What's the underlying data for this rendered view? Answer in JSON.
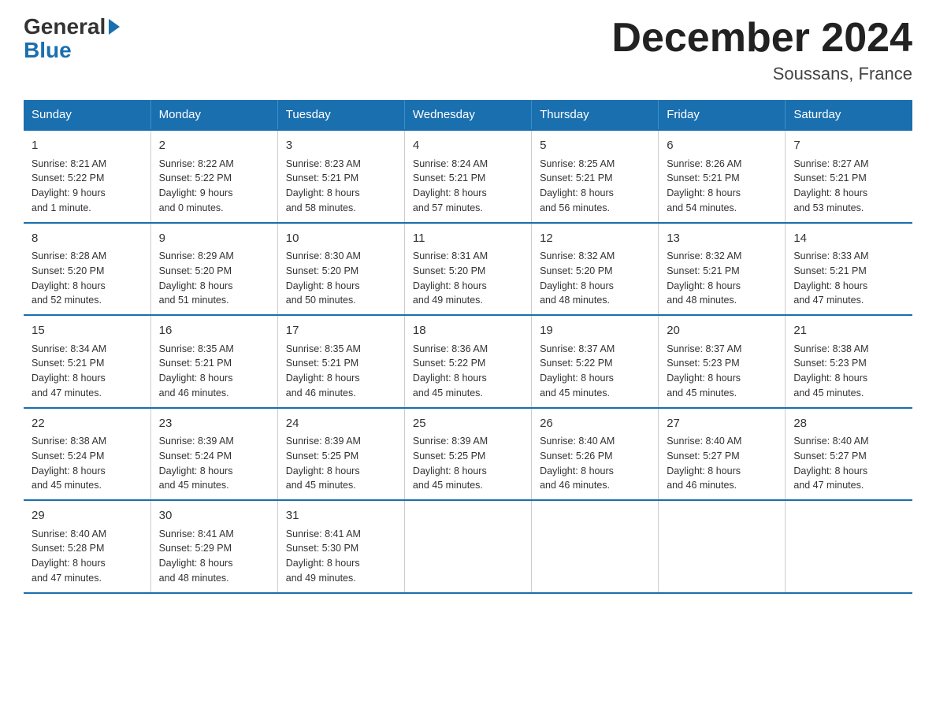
{
  "logo": {
    "general": "General",
    "blue": "Blue"
  },
  "title": "December 2024",
  "subtitle": "Soussans, France",
  "days_of_week": [
    "Sunday",
    "Monday",
    "Tuesday",
    "Wednesday",
    "Thursday",
    "Friday",
    "Saturday"
  ],
  "weeks": [
    [
      {
        "day": "1",
        "info": "Sunrise: 8:21 AM\nSunset: 5:22 PM\nDaylight: 9 hours\nand 1 minute."
      },
      {
        "day": "2",
        "info": "Sunrise: 8:22 AM\nSunset: 5:22 PM\nDaylight: 9 hours\nand 0 minutes."
      },
      {
        "day": "3",
        "info": "Sunrise: 8:23 AM\nSunset: 5:21 PM\nDaylight: 8 hours\nand 58 minutes."
      },
      {
        "day": "4",
        "info": "Sunrise: 8:24 AM\nSunset: 5:21 PM\nDaylight: 8 hours\nand 57 minutes."
      },
      {
        "day": "5",
        "info": "Sunrise: 8:25 AM\nSunset: 5:21 PM\nDaylight: 8 hours\nand 56 minutes."
      },
      {
        "day": "6",
        "info": "Sunrise: 8:26 AM\nSunset: 5:21 PM\nDaylight: 8 hours\nand 54 minutes."
      },
      {
        "day": "7",
        "info": "Sunrise: 8:27 AM\nSunset: 5:21 PM\nDaylight: 8 hours\nand 53 minutes."
      }
    ],
    [
      {
        "day": "8",
        "info": "Sunrise: 8:28 AM\nSunset: 5:20 PM\nDaylight: 8 hours\nand 52 minutes."
      },
      {
        "day": "9",
        "info": "Sunrise: 8:29 AM\nSunset: 5:20 PM\nDaylight: 8 hours\nand 51 minutes."
      },
      {
        "day": "10",
        "info": "Sunrise: 8:30 AM\nSunset: 5:20 PM\nDaylight: 8 hours\nand 50 minutes."
      },
      {
        "day": "11",
        "info": "Sunrise: 8:31 AM\nSunset: 5:20 PM\nDaylight: 8 hours\nand 49 minutes."
      },
      {
        "day": "12",
        "info": "Sunrise: 8:32 AM\nSunset: 5:20 PM\nDaylight: 8 hours\nand 48 minutes."
      },
      {
        "day": "13",
        "info": "Sunrise: 8:32 AM\nSunset: 5:21 PM\nDaylight: 8 hours\nand 48 minutes."
      },
      {
        "day": "14",
        "info": "Sunrise: 8:33 AM\nSunset: 5:21 PM\nDaylight: 8 hours\nand 47 minutes."
      }
    ],
    [
      {
        "day": "15",
        "info": "Sunrise: 8:34 AM\nSunset: 5:21 PM\nDaylight: 8 hours\nand 47 minutes."
      },
      {
        "day": "16",
        "info": "Sunrise: 8:35 AM\nSunset: 5:21 PM\nDaylight: 8 hours\nand 46 minutes."
      },
      {
        "day": "17",
        "info": "Sunrise: 8:35 AM\nSunset: 5:21 PM\nDaylight: 8 hours\nand 46 minutes."
      },
      {
        "day": "18",
        "info": "Sunrise: 8:36 AM\nSunset: 5:22 PM\nDaylight: 8 hours\nand 45 minutes."
      },
      {
        "day": "19",
        "info": "Sunrise: 8:37 AM\nSunset: 5:22 PM\nDaylight: 8 hours\nand 45 minutes."
      },
      {
        "day": "20",
        "info": "Sunrise: 8:37 AM\nSunset: 5:23 PM\nDaylight: 8 hours\nand 45 minutes."
      },
      {
        "day": "21",
        "info": "Sunrise: 8:38 AM\nSunset: 5:23 PM\nDaylight: 8 hours\nand 45 minutes."
      }
    ],
    [
      {
        "day": "22",
        "info": "Sunrise: 8:38 AM\nSunset: 5:24 PM\nDaylight: 8 hours\nand 45 minutes."
      },
      {
        "day": "23",
        "info": "Sunrise: 8:39 AM\nSunset: 5:24 PM\nDaylight: 8 hours\nand 45 minutes."
      },
      {
        "day": "24",
        "info": "Sunrise: 8:39 AM\nSunset: 5:25 PM\nDaylight: 8 hours\nand 45 minutes."
      },
      {
        "day": "25",
        "info": "Sunrise: 8:39 AM\nSunset: 5:25 PM\nDaylight: 8 hours\nand 45 minutes."
      },
      {
        "day": "26",
        "info": "Sunrise: 8:40 AM\nSunset: 5:26 PM\nDaylight: 8 hours\nand 46 minutes."
      },
      {
        "day": "27",
        "info": "Sunrise: 8:40 AM\nSunset: 5:27 PM\nDaylight: 8 hours\nand 46 minutes."
      },
      {
        "day": "28",
        "info": "Sunrise: 8:40 AM\nSunset: 5:27 PM\nDaylight: 8 hours\nand 47 minutes."
      }
    ],
    [
      {
        "day": "29",
        "info": "Sunrise: 8:40 AM\nSunset: 5:28 PM\nDaylight: 8 hours\nand 47 minutes."
      },
      {
        "day": "30",
        "info": "Sunrise: 8:41 AM\nSunset: 5:29 PM\nDaylight: 8 hours\nand 48 minutes."
      },
      {
        "day": "31",
        "info": "Sunrise: 8:41 AM\nSunset: 5:30 PM\nDaylight: 8 hours\nand 49 minutes."
      },
      {
        "day": "",
        "info": ""
      },
      {
        "day": "",
        "info": ""
      },
      {
        "day": "",
        "info": ""
      },
      {
        "day": "",
        "info": ""
      }
    ]
  ]
}
